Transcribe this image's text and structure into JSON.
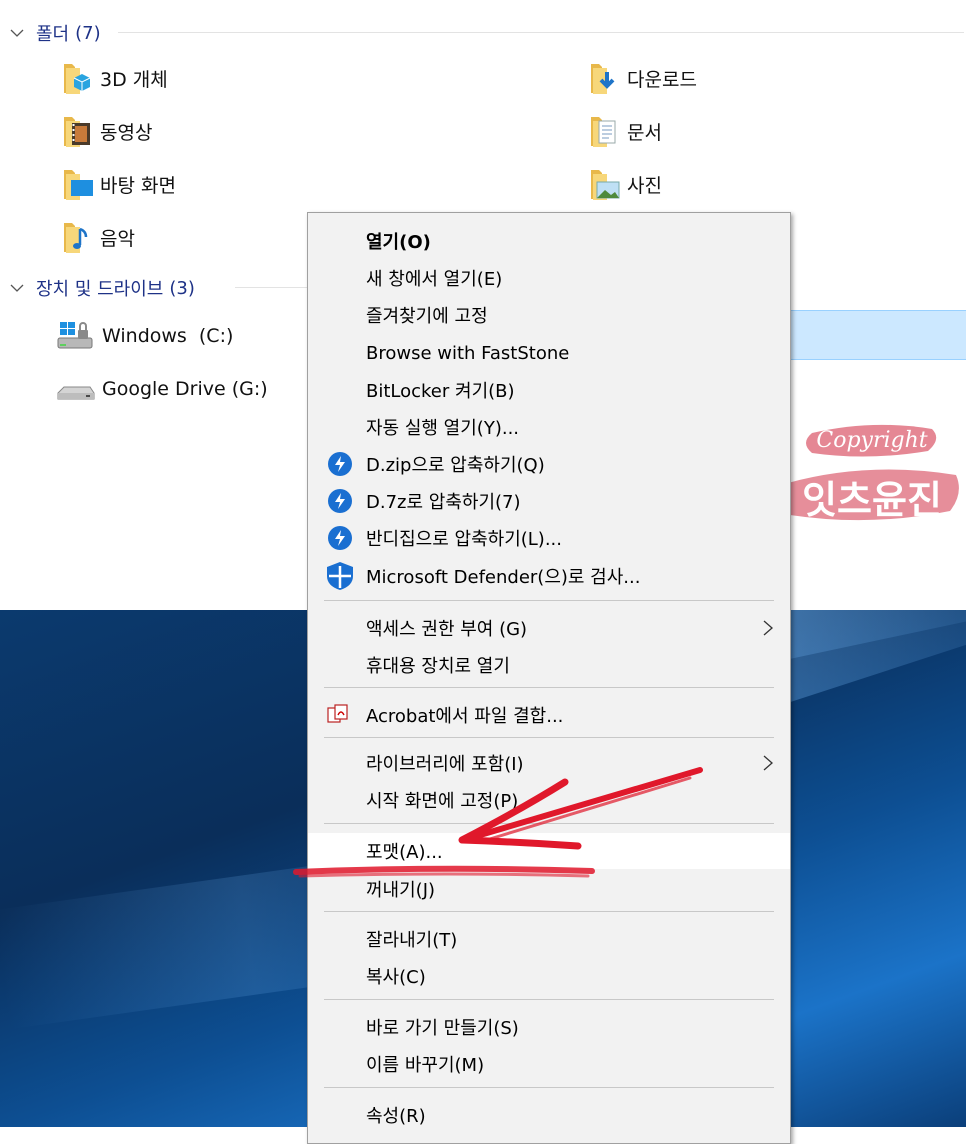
{
  "folders_group": {
    "label": "폴더",
    "count": "(7)"
  },
  "folders": [
    {
      "name": "3D 개체",
      "icon": "3d-objects-folder-icon"
    },
    {
      "name": "다운로드",
      "icon": "downloads-folder-icon"
    },
    {
      "name": "동영상",
      "icon": "videos-folder-icon"
    },
    {
      "name": "문서",
      "icon": "documents-folder-icon"
    },
    {
      "name": "바탕 화면",
      "icon": "desktop-folder-icon"
    },
    {
      "name": "사진",
      "icon": "pictures-folder-icon"
    },
    {
      "name": "음악",
      "icon": "music-folder-icon"
    }
  ],
  "drives_group": {
    "label": "장치 및 드라이브",
    "count": "(3)"
  },
  "drives": [
    {
      "name": "Windows  (C:)",
      "icon": "windows-drive-icon"
    },
    {
      "name": "Google Drive (G:)",
      "icon": "google-drive-icon"
    }
  ],
  "menu": {
    "open": "열기(O)",
    "open_new_window": "새 창에서 열기(E)",
    "pin_quick_access": "즐겨찾기에 고정",
    "browse_faststone": "Browse with FastStone",
    "bitlocker": "BitLocker 켜기(B)",
    "autoplay": "자동 실행 열기(Y)...",
    "zip": "D.zip으로 압축하기(Q)",
    "sevenz": "D.7z로 압축하기(7)",
    "bandizip": "반디집으로 압축하기(L)...",
    "defender": "Microsoft Defender(으)로 검사...",
    "give_access": "액세스 권한 부여 (G)",
    "open_portable": "휴대용 장치로 열기",
    "acrobat": "Acrobat에서 파일 결합...",
    "include_library": "라이브러리에 포함(I)",
    "pin_start": "시작 화면에 고정(P)",
    "format": "포맷(A)...",
    "eject": "꺼내기(J)",
    "cut": "잘라내기(T)",
    "copy": "복사(C)",
    "create_shortcut": "바로 가기 만들기(S)",
    "rename": "이름 바꾸기(M)",
    "properties": "속성(R)"
  },
  "watermark": {
    "line1": "Copyright",
    "line2": "잇츠윤진"
  },
  "colors": {
    "group_header": "#1e3287",
    "menu_bg": "#f2f2f2",
    "bandizip_blue": "#1a6fd1",
    "annotation_red": "#e0182b"
  }
}
